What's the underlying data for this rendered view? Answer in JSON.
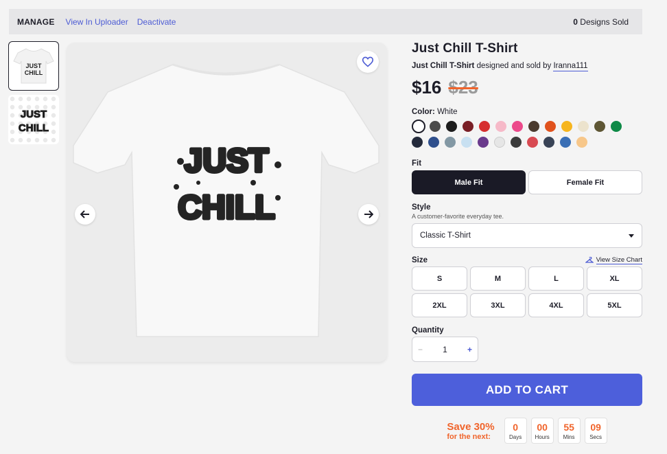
{
  "topbar": {
    "manage": "MANAGE",
    "view_uploader": "View In Uploader",
    "deactivate": "Deactivate",
    "sold_count": "0",
    "sold_label": "Designs Sold"
  },
  "product": {
    "title": "Just Chill T-Shirt",
    "byline_title": "Just Chill T-Shirt",
    "byline_text": "designed and sold by",
    "artist": "Iranna111",
    "price_now": "$16",
    "price_was": "$23",
    "design_word1": "JUST",
    "design_word2": "CHILL"
  },
  "color": {
    "label": "Color:",
    "selected": "White",
    "swatches": [
      "#ffffff",
      "#4a4a4a",
      "#1c1c1c",
      "#7a1f26",
      "#d62f30",
      "#f6b9c8",
      "#ec4a8b",
      "#4b3a2e",
      "#e0521d",
      "#f6b51e",
      "#ece3cd",
      "#5e5634",
      "#0e8a47",
      "#232a3b",
      "#2f4f8c",
      "#8398a4",
      "#c8e0f1",
      "#6a3a8c",
      "#e6e6e6",
      "#3b3b3b",
      "#d84a52",
      "#394356",
      "#3a6fb5",
      "#f7c78a"
    ]
  },
  "fit": {
    "label": "Fit",
    "options": [
      "Male Fit",
      "Female Fit"
    ]
  },
  "style": {
    "label": "Style",
    "description": "A customer-favorite everyday tee.",
    "value": "Classic T-Shirt"
  },
  "size": {
    "label": "Size",
    "chart_link": "View Size Chart",
    "options": [
      "S",
      "M",
      "L",
      "XL",
      "2XL",
      "3XL",
      "4XL",
      "5XL"
    ]
  },
  "quantity": {
    "label": "Quantity",
    "value": "1",
    "minus": "−",
    "plus": "+"
  },
  "cart": {
    "label": "ADD TO CART"
  },
  "promo": {
    "save": "Save 30%",
    "for_next": "for the next:",
    "timer": [
      {
        "n": "0",
        "u": "Days"
      },
      {
        "n": "00",
        "u": "Hours"
      },
      {
        "n": "55",
        "u": "Mins"
      },
      {
        "n": "09",
        "u": "Secs"
      }
    ]
  }
}
